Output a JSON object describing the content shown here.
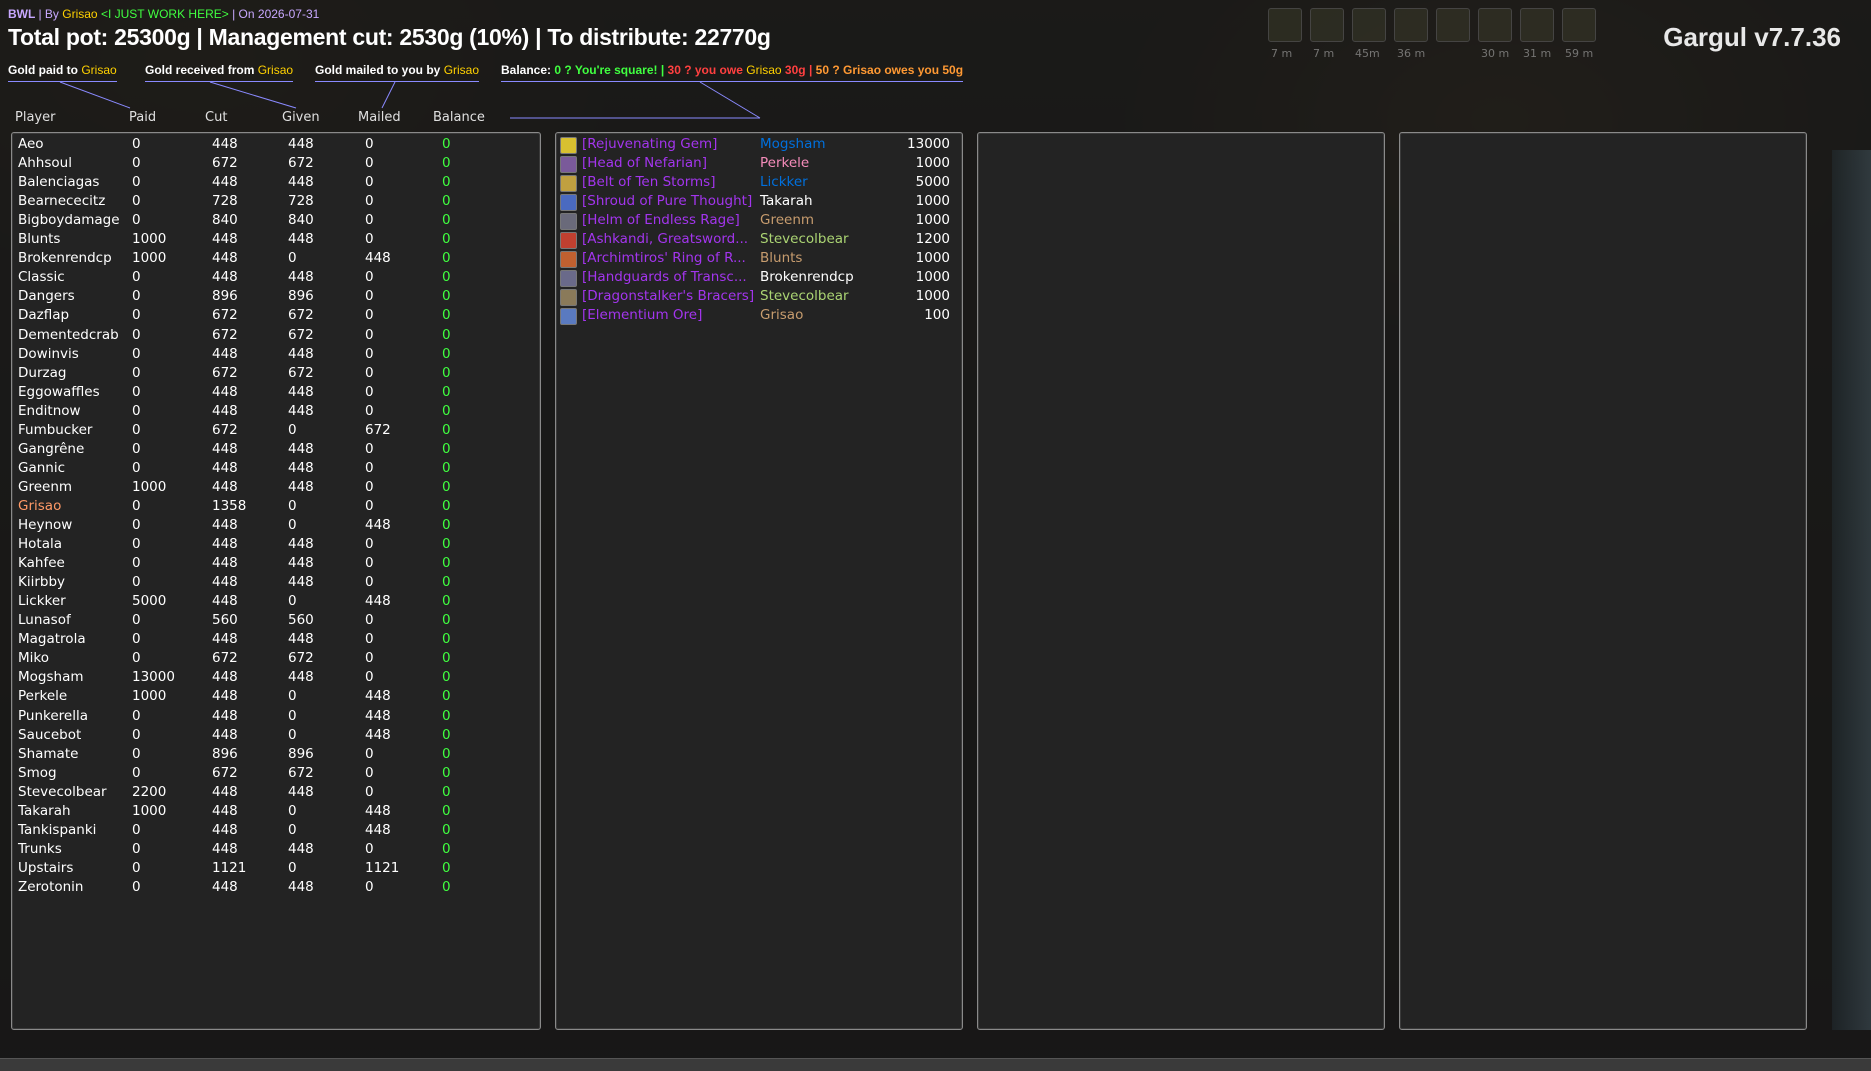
{
  "header": {
    "raid": "BWL",
    "by_label": "| By",
    "author": "Grisao",
    "guild": "<I JUST WORK HERE>",
    "date_text": "| On 2026-07-31",
    "title": "Total pot: 25300g | Management cut: 2530g (10%) | To distribute: 22770g",
    "version": "Gargul v7.7.36"
  },
  "buffs": [
    "7 m",
    "7 m",
    "45m",
    "36 m",
    "",
    "30 m",
    "31 m",
    "59 m"
  ],
  "legend": {
    "paid": {
      "label": "Gold paid to",
      "who": "Grisao"
    },
    "received": {
      "label": "Gold received from",
      "who": "Grisao"
    },
    "mailed": {
      "label": "Gold mailed to you by",
      "who": "Grisao"
    },
    "balance": {
      "label": "Balance:",
      "square": "0 ? You're square!",
      "sep1": "|",
      "owe": "30 ? you owe",
      "owe_who": "Grisao",
      "owe_amt": "30g",
      "sep2": "|",
      "owed": "50 ? Grisao owes you 50g"
    }
  },
  "columns": {
    "player": "Player",
    "paid": "Paid",
    "cut": "Cut",
    "given": "Given",
    "mailed": "Mailed",
    "balance": "Balance"
  },
  "players": [
    {
      "name": "Aeo",
      "paid": "0",
      "cut": "448",
      "given": "448",
      "mailed": "0",
      "balance": "0"
    },
    {
      "name": "Ahhsoul",
      "paid": "0",
      "cut": "672",
      "given": "672",
      "mailed": "0",
      "balance": "0"
    },
    {
      "name": "Balenciagas",
      "paid": "0",
      "cut": "448",
      "given": "448",
      "mailed": "0",
      "balance": "0"
    },
    {
      "name": "Bearnececitz",
      "paid": "0",
      "cut": "728",
      "given": "728",
      "mailed": "0",
      "balance": "0"
    },
    {
      "name": "Bigboydamage",
      "paid": "0",
      "cut": "840",
      "given": "840",
      "mailed": "0",
      "balance": "0"
    },
    {
      "name": "Blunts",
      "paid": "1000",
      "cut": "448",
      "given": "448",
      "mailed": "0",
      "balance": "0"
    },
    {
      "name": "Brokenrendcp",
      "paid": "1000",
      "cut": "448",
      "given": "0",
      "mailed": "448",
      "balance": "0"
    },
    {
      "name": "Classic",
      "paid": "0",
      "cut": "448",
      "given": "448",
      "mailed": "0",
      "balance": "0"
    },
    {
      "name": "Dangers",
      "paid": "0",
      "cut": "896",
      "given": "896",
      "mailed": "0",
      "balance": "0"
    },
    {
      "name": "Dazflap",
      "paid": "0",
      "cut": "672",
      "given": "672",
      "mailed": "0",
      "balance": "0"
    },
    {
      "name": "Dementedcrab",
      "paid": "0",
      "cut": "672",
      "given": "672",
      "mailed": "0",
      "balance": "0"
    },
    {
      "name": "Dowinvis",
      "paid": "0",
      "cut": "448",
      "given": "448",
      "mailed": "0",
      "balance": "0"
    },
    {
      "name": "Durzag",
      "paid": "0",
      "cut": "672",
      "given": "672",
      "mailed": "0",
      "balance": "0"
    },
    {
      "name": "Eggowaffles",
      "paid": "0",
      "cut": "448",
      "given": "448",
      "mailed": "0",
      "balance": "0"
    },
    {
      "name": "Enditnow",
      "paid": "0",
      "cut": "448",
      "given": "448",
      "mailed": "0",
      "balance": "0"
    },
    {
      "name": "Fumbucker",
      "paid": "0",
      "cut": "672",
      "given": "0",
      "mailed": "672",
      "balance": "0"
    },
    {
      "name": "Gangrêne",
      "paid": "0",
      "cut": "448",
      "given": "448",
      "mailed": "0",
      "balance": "0"
    },
    {
      "name": "Gannic",
      "paid": "0",
      "cut": "448",
      "given": "448",
      "mailed": "0",
      "balance": "0"
    },
    {
      "name": "Greenm",
      "paid": "1000",
      "cut": "448",
      "given": "448",
      "mailed": "0",
      "balance": "0"
    },
    {
      "name": "Grisao",
      "paid": "0",
      "cut": "1358",
      "given": "0",
      "mailed": "0",
      "balance": "0",
      "self": true
    },
    {
      "name": "Heynow",
      "paid": "0",
      "cut": "448",
      "given": "0",
      "mailed": "448",
      "balance": "0"
    },
    {
      "name": "Hotala",
      "paid": "0",
      "cut": "448",
      "given": "448",
      "mailed": "0",
      "balance": "0"
    },
    {
      "name": "Kahfee",
      "paid": "0",
      "cut": "448",
      "given": "448",
      "mailed": "0",
      "balance": "0"
    },
    {
      "name": "Kiirbby",
      "paid": "0",
      "cut": "448",
      "given": "448",
      "mailed": "0",
      "balance": "0"
    },
    {
      "name": "Lickker",
      "paid": "5000",
      "cut": "448",
      "given": "0",
      "mailed": "448",
      "balance": "0"
    },
    {
      "name": "Lunasof",
      "paid": "0",
      "cut": "560",
      "given": "560",
      "mailed": "0",
      "balance": "0"
    },
    {
      "name": "Magatrola",
      "paid": "0",
      "cut": "448",
      "given": "448",
      "mailed": "0",
      "balance": "0"
    },
    {
      "name": "Miko",
      "paid": "0",
      "cut": "672",
      "given": "672",
      "mailed": "0",
      "balance": "0"
    },
    {
      "name": "Mogsham",
      "paid": "13000",
      "cut": "448",
      "given": "448",
      "mailed": "0",
      "balance": "0"
    },
    {
      "name": "Perkele",
      "paid": "1000",
      "cut": "448",
      "given": "0",
      "mailed": "448",
      "balance": "0"
    },
    {
      "name": "Punkerella",
      "paid": "0",
      "cut": "448",
      "given": "0",
      "mailed": "448",
      "balance": "0"
    },
    {
      "name": "Saucebot",
      "paid": "0",
      "cut": "448",
      "given": "0",
      "mailed": "448",
      "balance": "0"
    },
    {
      "name": "Shamate",
      "paid": "0",
      "cut": "896",
      "given": "896",
      "mailed": "0",
      "balance": "0"
    },
    {
      "name": "Smog",
      "paid": "0",
      "cut": "672",
      "given": "672",
      "mailed": "0",
      "balance": "0"
    },
    {
      "name": "Stevecolbear",
      "paid": "2200",
      "cut": "448",
      "given": "448",
      "mailed": "0",
      "balance": "0"
    },
    {
      "name": "Takarah",
      "paid": "1000",
      "cut": "448",
      "given": "0",
      "mailed": "448",
      "balance": "0"
    },
    {
      "name": "Tankispanki",
      "paid": "0",
      "cut": "448",
      "given": "0",
      "mailed": "448",
      "balance": "0"
    },
    {
      "name": "Trunks",
      "paid": "0",
      "cut": "448",
      "given": "448",
      "mailed": "0",
      "balance": "0"
    },
    {
      "name": "Upstairs",
      "paid": "0",
      "cut": "1121",
      "given": "0",
      "mailed": "1121",
      "balance": "0"
    },
    {
      "name": "Zerotonin",
      "paid": "0",
      "cut": "448",
      "given": "448",
      "mailed": "0",
      "balance": "0"
    }
  ],
  "items": [
    {
      "name": "[Rejuvenating Gem]",
      "winner": "Mogsham",
      "winner_color": "#0070dd",
      "price": "13000",
      "icon_color": "#d8c030"
    },
    {
      "name": "[Head of Nefarian]",
      "winner": "Perkele",
      "winner_color": "#f58cba",
      "price": "1000",
      "icon_color": "#7a5a9a"
    },
    {
      "name": "[Belt of Ten Storms]",
      "winner": "Lickker",
      "winner_color": "#0070dd",
      "price": "5000",
      "icon_color": "#c0a040"
    },
    {
      "name": "[Shroud of Pure Thought]",
      "winner": "Takarah",
      "winner_color": "#ffffff",
      "price": "1000",
      "icon_color": "#4a6ac0"
    },
    {
      "name": "[Helm of Endless Rage]",
      "winner": "Greenm",
      "winner_color": "#c79c6e",
      "price": "1000",
      "icon_color": "#6a6a7a"
    },
    {
      "name": "[Ashkandi, Greatsword...",
      "winner": "Stevecolbear",
      "winner_color": "#abd473",
      "price": "1200",
      "icon_color": "#c04030"
    },
    {
      "name": "[Archimtiros' Ring of R...",
      "winner": "Blunts",
      "winner_color": "#c79c6e",
      "price": "1000",
      "icon_color": "#c06030"
    },
    {
      "name": "[Handguards of Transc...",
      "winner": "Brokenrendcp",
      "winner_color": "#ffffff",
      "price": "1000",
      "icon_color": "#6a6a8a"
    },
    {
      "name": "[Dragonstalker's Bracers]",
      "winner": "Stevecolbear",
      "winner_color": "#abd473",
      "price": "1000",
      "icon_color": "#8a7a5a"
    },
    {
      "name": "[Elementium Ore]",
      "winner": "Grisao",
      "winner_color": "#c79c6e",
      "price": "100",
      "icon_color": "#5a7ac0"
    }
  ]
}
